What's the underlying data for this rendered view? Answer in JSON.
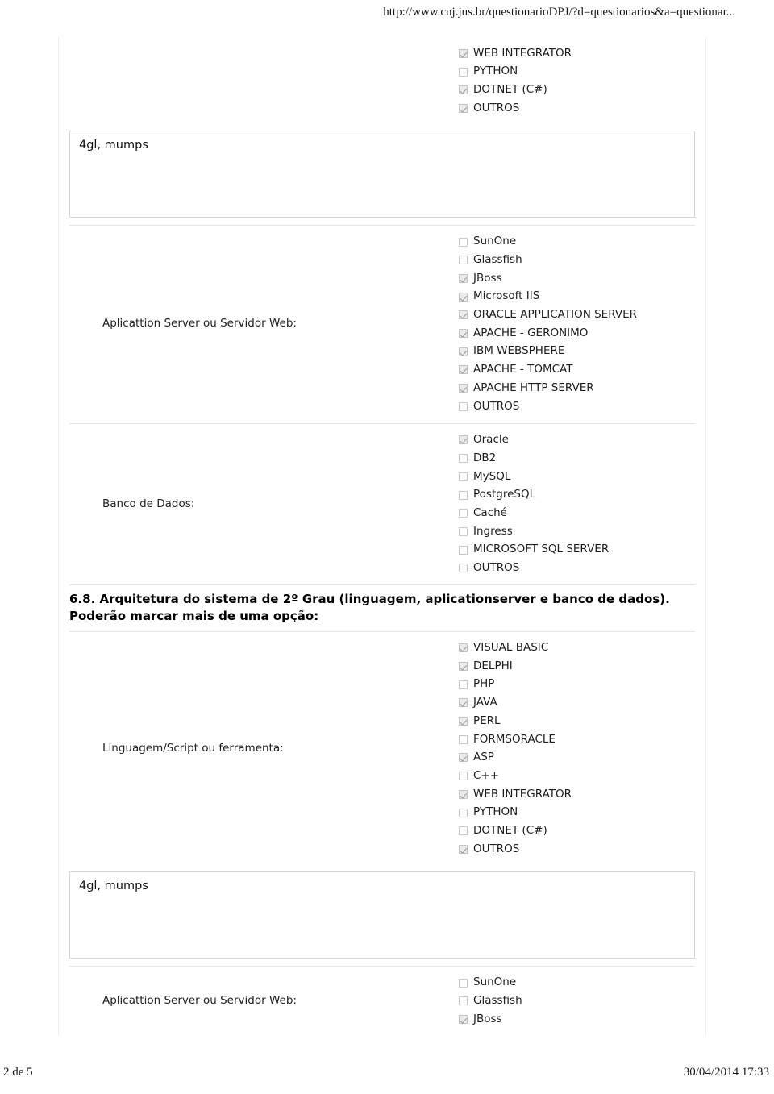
{
  "print": {
    "url": "http://www.cnj.jus.br/questionarioDPJ/?d=questionarios&a=questionar...",
    "page_number": "2 de 5",
    "timestamp": "30/04/2014 17:33"
  },
  "blocks": {
    "top_language_options": [
      {
        "label": "WEB INTEGRATOR",
        "checked": true
      },
      {
        "label": "PYTHON",
        "checked": false
      },
      {
        "label": "DOTNET (C#)",
        "checked": true
      },
      {
        "label": "OUTROS",
        "checked": true
      }
    ],
    "top_textarea": {
      "value": "4gl, mumps"
    },
    "appserver_1": {
      "label": "Aplicattion Server ou Servidor Web:",
      "options": [
        {
          "label": "SunOne",
          "checked": false
        },
        {
          "label": "Glassfish",
          "checked": false
        },
        {
          "label": "JBoss",
          "checked": true
        },
        {
          "label": "Microsoft IIS",
          "checked": true
        },
        {
          "label": "ORACLE APPLICATION SERVER",
          "checked": true
        },
        {
          "label": "APACHE - GERONIMO",
          "checked": true
        },
        {
          "label": "IBM WEBSPHERE",
          "checked": true
        },
        {
          "label": "APACHE - TOMCAT",
          "checked": true
        },
        {
          "label": "APACHE HTTP SERVER",
          "checked": true
        },
        {
          "label": "OUTROS",
          "checked": false
        }
      ]
    },
    "database": {
      "label": "Banco de Dados:",
      "options": [
        {
          "label": "Oracle",
          "checked": true
        },
        {
          "label": "DB2",
          "checked": false
        },
        {
          "label": "MySQL",
          "checked": false
        },
        {
          "label": "PostgreSQL",
          "checked": false
        },
        {
          "label": "Caché",
          "checked": false
        },
        {
          "label": "Ingress",
          "checked": false
        },
        {
          "label": "MICROSOFT SQL SERVER",
          "checked": false
        },
        {
          "label": "OUTROS",
          "checked": false
        }
      ]
    },
    "question_68": {
      "heading": "6.8. Arquitetura do sistema de 2º Grau (linguagem, aplicationserver e banco de dados). Poderão marcar mais de uma opção:"
    },
    "language": {
      "label": "Linguagem/Script ou ferramenta:",
      "options": [
        {
          "label": "VISUAL BASIC",
          "checked": true
        },
        {
          "label": "DELPHI",
          "checked": true
        },
        {
          "label": "PHP",
          "checked": false
        },
        {
          "label": "JAVA",
          "checked": true
        },
        {
          "label": "PERL",
          "checked": true
        },
        {
          "label": "FORMSORACLE",
          "checked": false
        },
        {
          "label": "ASP",
          "checked": true
        },
        {
          "label": "C++",
          "checked": false
        },
        {
          "label": "WEB INTEGRATOR",
          "checked": true
        },
        {
          "label": "PYTHON",
          "checked": false
        },
        {
          "label": "DOTNET (C#)",
          "checked": false
        },
        {
          "label": "OUTROS",
          "checked": true
        }
      ]
    },
    "bottom_textarea": {
      "value": "4gl, mumps"
    },
    "appserver_2": {
      "label": "Aplicattion Server ou Servidor Web:",
      "options": [
        {
          "label": "SunOne",
          "checked": false
        },
        {
          "label": "Glassfish",
          "checked": false
        },
        {
          "label": "JBoss",
          "checked": true
        }
      ]
    }
  }
}
